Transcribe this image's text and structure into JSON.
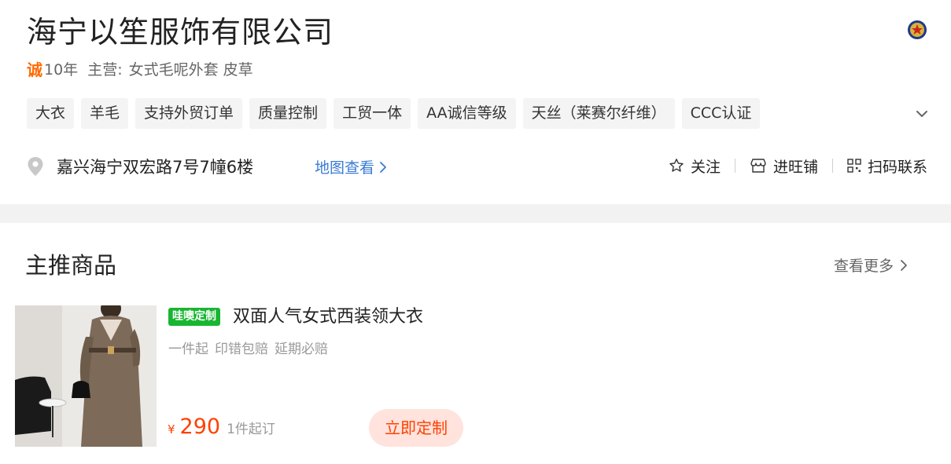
{
  "shop": {
    "name": "海宁以笙服饰有限公司",
    "cheng_icon": "诚",
    "years": "10年",
    "main_label": "主营:",
    "main_value": "女式毛呢外套 皮草",
    "tags": [
      "大衣",
      "羊毛",
      "支持外贸订单",
      "质量控制",
      "工贸一体",
      "AA诚信等级",
      "天丝（莱赛尔纤维）",
      "CCC认证"
    ],
    "address": "嘉兴海宁双宏路7号7幢6楼",
    "map_link": "地图查看",
    "actions": {
      "follow": "关注",
      "enter_store": "进旺铺",
      "scan_contact": "扫码联系"
    },
    "icons": {
      "police_badge": "police-badge-icon",
      "expand": "chevron-down-icon",
      "location": "map-pin-icon",
      "follow": "star-icon",
      "store": "store-icon",
      "scan": "qr-code-icon"
    }
  },
  "featured": {
    "title": "主推商品",
    "see_more": "查看更多",
    "product": {
      "badge": "哇噢定制",
      "name": "双面人气女式西装领大衣",
      "features": [
        "一件起",
        "印错包赔",
        "延期必赔"
      ],
      "price_symbol": "¥",
      "price": "290",
      "moq": "1件起订",
      "cta": "立即定制"
    }
  },
  "colors": {
    "accent": "#ff6a00",
    "price": "#ff4000",
    "link": "#3a7bd5",
    "badge_green": "#18b531",
    "cta_bg": "#ffe3dc"
  }
}
